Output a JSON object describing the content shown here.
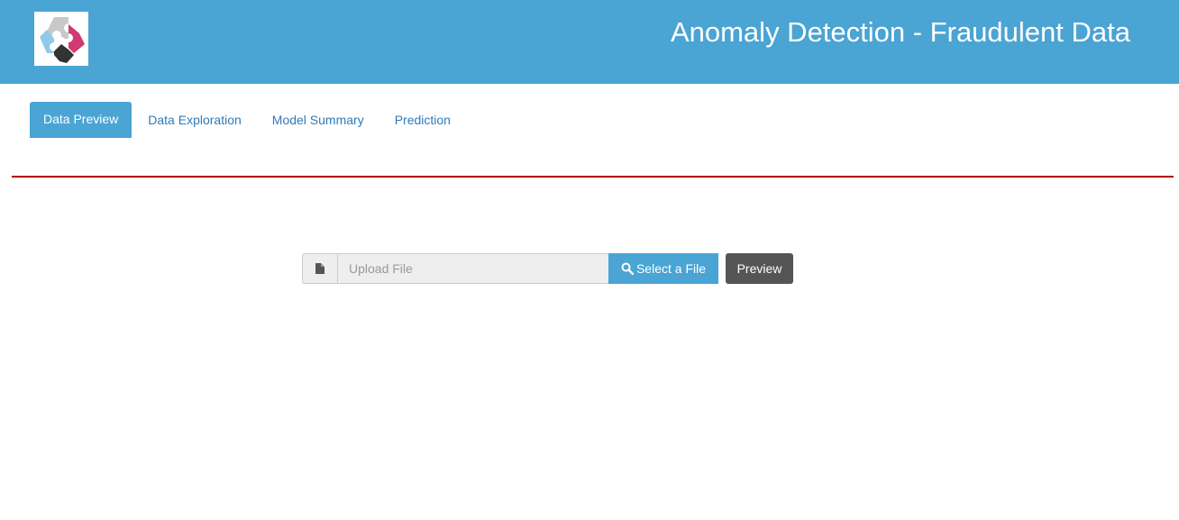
{
  "header": {
    "title": "Anomaly Detection - Fraudulent Data",
    "logo_icon": "puzzle-logo-icon"
  },
  "tabs": [
    {
      "label": "Data Preview",
      "active": true
    },
    {
      "label": "Data Exploration",
      "active": false
    },
    {
      "label": "Model Summary",
      "active": false
    },
    {
      "label": "Prediction",
      "active": false
    }
  ],
  "upload": {
    "file_icon": "file-icon",
    "placeholder": "Upload File",
    "value": "",
    "select_label": "Select a File",
    "search_icon": "search-icon"
  },
  "preview_label": "Preview",
  "colors": {
    "header_bg": "#4aa4d4",
    "divider": "#b30000",
    "preview_bg": "#555555"
  }
}
